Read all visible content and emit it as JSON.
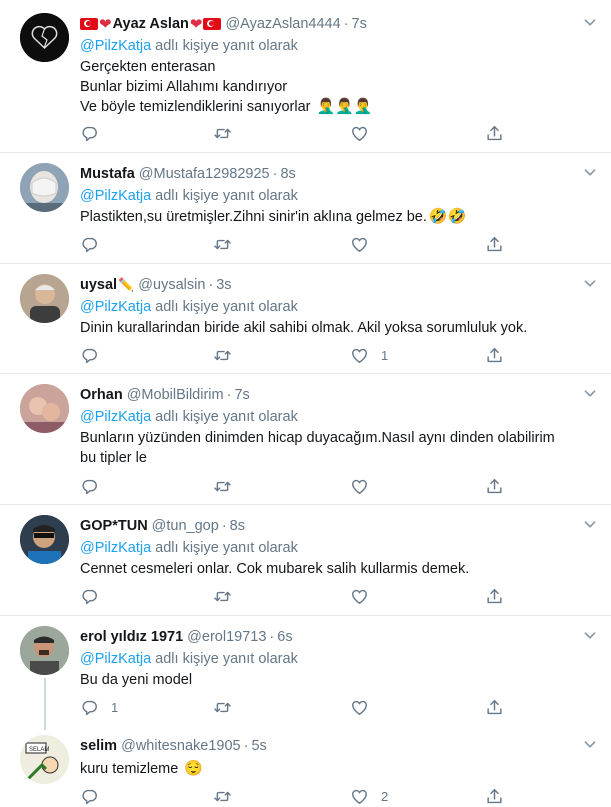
{
  "tweets": [
    {
      "name": "Ayaz Aslan",
      "handle": "@AyazAslan4444",
      "time": "7s",
      "reply_to": "@PilzKatja",
      "reply_suffix": "adlı kişiye yanıt olarak",
      "body": "Gerçekten enterasan\nBunlar bizimi Allahımı kandırıyor\nVe böyle temizlendiklerini sanıyorlar",
      "body_emoji": "🤦‍♂️🤦‍♂️🤦‍♂️",
      "likes": ""
    },
    {
      "name": "Mustafa",
      "handle": "@Mustafa12982925",
      "time": "8s",
      "reply_to": "@PilzKatja",
      "reply_suffix": "adlı kişiye yanıt olarak",
      "body": "Plastikten,su üretmişler.Zihni sinir'in aklına gelmez be.",
      "body_emoji": "🤣🤣",
      "likes": ""
    },
    {
      "name": "uysal",
      "handle": "@uysalsin",
      "time": "3s",
      "reply_to": "@PilzKatja",
      "reply_suffix": "adlı kişiye yanıt olarak",
      "body": "Dinin kurallarindan biride akil sahibi olmak. Akil yoksa sorumluluk yok.",
      "body_emoji": "",
      "likes": "1"
    },
    {
      "name": "Orhan",
      "handle": "@MobilBildirim",
      "time": "7s",
      "reply_to": "@PilzKatja",
      "reply_suffix": "adlı kişiye yanıt olarak",
      "body": "Bunların yüzünden dinimden hicap duyacağım.Nasıl aynı dinden olabilirim\nbu tipler le",
      "body_emoji": "",
      "likes": ""
    },
    {
      "name": "GOP*TUN",
      "handle": "@tun_gop",
      "time": "8s",
      "reply_to": "@PilzKatja",
      "reply_suffix": "adlı kişiye yanıt olarak",
      "body": "Cennet cesmeleri onlar. Cok mubarek salih kullarmis demek.",
      "body_emoji": "",
      "likes": ""
    },
    {
      "name": "erol yıldız 1971",
      "handle": "@erol19713",
      "time": "6s",
      "reply_to": "@PilzKatja",
      "reply_suffix": "adlı kişiye yanıt olarak",
      "body": "Bu da yeni model",
      "body_emoji": "",
      "replies": "1",
      "likes": ""
    },
    {
      "name": "selim",
      "handle": "@whitesnake1905",
      "time": "5s",
      "body": "kuru temizleme",
      "body_emoji": "😌",
      "likes": "2"
    }
  ],
  "separator": "·",
  "icons": {
    "reply": "reply-icon",
    "retweet": "retweet-icon",
    "like": "heart-icon",
    "share": "share-icon",
    "more": "chevron-down-icon"
  },
  "colors": {
    "accent": "#1da1f2",
    "secondary_text": "#657786",
    "divider": "#e6ecf0",
    "thread_line": "#ccd6dd"
  }
}
